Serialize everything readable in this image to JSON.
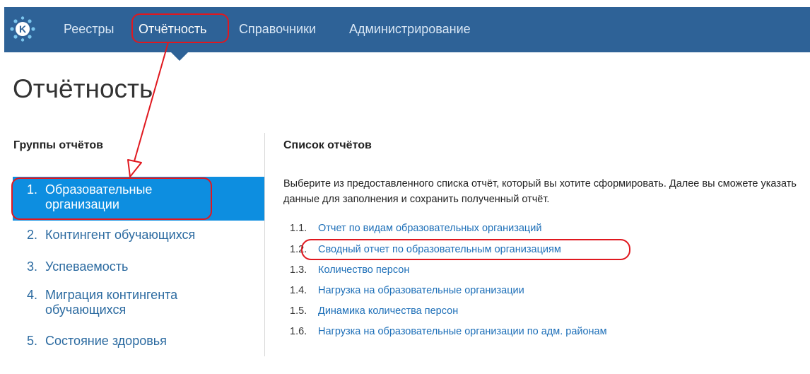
{
  "colors": {
    "topbar": "#2e6297",
    "active_group": "#0d8ee0",
    "link": "#1d6fb8",
    "annotation": "#e0181f"
  },
  "nav": {
    "logo_letter": "K",
    "items": [
      {
        "label": "Реестры"
      },
      {
        "label": "Отчётность"
      },
      {
        "label": "Справочники"
      },
      {
        "label": "Администрирование"
      }
    ]
  },
  "page": {
    "title": "Отчётность"
  },
  "groups": {
    "header": "Группы отчётов",
    "items": [
      {
        "num": "1.",
        "label": "Образовательные организации"
      },
      {
        "num": "2.",
        "label": "Контингент обучающихся"
      },
      {
        "num": "3.",
        "label": "Успеваемость"
      },
      {
        "num": "4.",
        "label": "Миграция контингента обучающихся"
      },
      {
        "num": "5.",
        "label": "Состояние здоровья"
      }
    ]
  },
  "reports": {
    "header": "Список отчётов",
    "description": "Выберите из предоставленного списка отчёт, который вы хотите сформировать. Далее вы сможете указать данные для заполнения и сохранить полученный отчёт.",
    "items": [
      {
        "num": "1.1.",
        "label": "Отчет по видам образовательных организаций"
      },
      {
        "num": "1.2.",
        "label": "Сводный отчет по образовательным организациям"
      },
      {
        "num": "1.3.",
        "label": "Количество персон"
      },
      {
        "num": "1.4.",
        "label": "Нагрузка на образовательные организации"
      },
      {
        "num": "1.5.",
        "label": "Динамика количества персон"
      },
      {
        "num": "1.6.",
        "label": "Нагрузка на образовательные организации по адм. районам"
      }
    ]
  }
}
